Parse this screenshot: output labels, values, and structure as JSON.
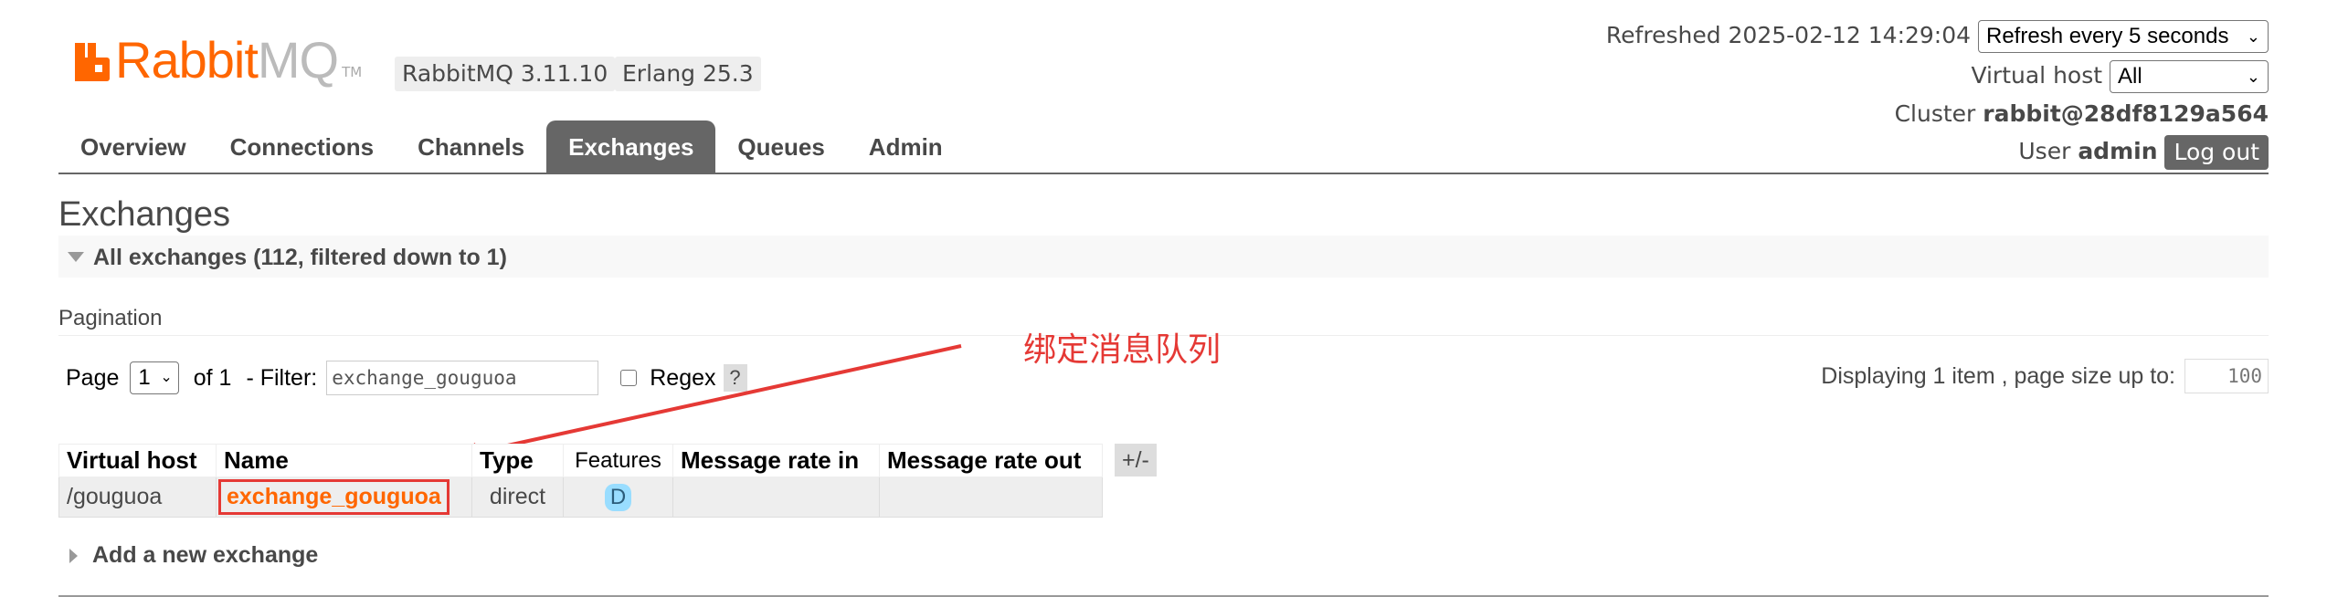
{
  "header": {
    "logo_rabbit": "Rabbit",
    "logo_mq": "MQ",
    "logo_tm": "TM",
    "rabbitmq_version": "RabbitMQ 3.11.10",
    "erlang_version": "Erlang 25.3",
    "refreshed_label": "Refreshed 2025-02-12 14:29:04",
    "refresh_select": "Refresh every 5 seconds",
    "virtual_host_label": "Virtual host",
    "virtual_host_select": "All",
    "cluster_label": "Cluster",
    "cluster_name": "rabbit@28df8129a564",
    "user_label": "User",
    "user_name": "admin",
    "logout_label": "Log out"
  },
  "tabs": [
    {
      "label": "Overview",
      "active": false
    },
    {
      "label": "Connections",
      "active": false
    },
    {
      "label": "Channels",
      "active": false
    },
    {
      "label": "Exchanges",
      "active": true
    },
    {
      "label": "Queues",
      "active": false
    },
    {
      "label": "Admin",
      "active": false
    }
  ],
  "page": {
    "title": "Exchanges",
    "section_label": "All exchanges (112, filtered down to 1)",
    "pagination_label": "Pagination",
    "page_label": "Page",
    "page_select": "1",
    "of_label": "of 1",
    "filter_label": "- Filter:",
    "filter_value": "exchange_gouguoa",
    "regex_label": "Regex",
    "help_label": "?",
    "display_label": "Displaying 1 item , page size up to:",
    "page_size": "100"
  },
  "annotation": {
    "text": "绑定消息队列",
    "color": "#e53935"
  },
  "table": {
    "headers": [
      "Virtual host",
      "Name",
      "Type",
      "Features",
      "Message rate in",
      "Message rate out"
    ],
    "toggle_columns": "+/-",
    "rows": [
      {
        "virtual_host": "/gouguoa",
        "name": "exchange_gouguoa",
        "type": "direct",
        "features": "D",
        "rate_in": "",
        "rate_out": ""
      }
    ]
  },
  "add_exchange_label": "Add a new exchange",
  "colors": {
    "accent": "#ff6600",
    "tab_active": "#666666",
    "annotation": "#e53935"
  }
}
